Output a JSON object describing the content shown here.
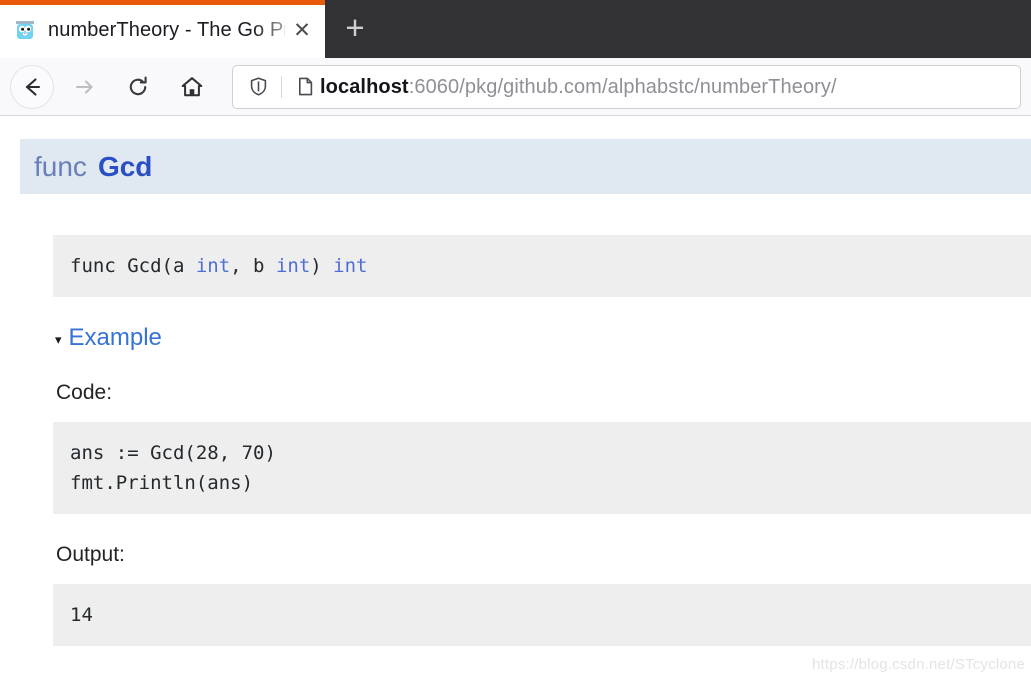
{
  "browser": {
    "tab": {
      "favicon": "go-gopher-icon",
      "title": "numberTheory - The Go Programming Language",
      "close_label": "✕"
    },
    "newtab_label": "+",
    "nav": {
      "back_label": "←",
      "forward_label": "→",
      "reload_label": "⟳",
      "home_label": "⌂"
    },
    "urlbar": {
      "shield_icon": "shield-icon",
      "page_icon": "page-info-icon",
      "host": "localhost",
      "path": ":6060/pkg/github.com/alphabstc/numberTheory/"
    }
  },
  "page": {
    "func_header": {
      "keyword": "func",
      "name": "Gcd"
    },
    "signature": "func Gcd(a int, b int) int",
    "signature_parts": {
      "pre": "func Gcd(a ",
      "type1": "int",
      "mid": ", b ",
      "type2": "int",
      "close": ") ",
      "type3": "int"
    },
    "example": {
      "caret": "▾",
      "label": "Example",
      "code_label": "Code:",
      "code": "ans := Gcd(28, 70)\nfmt.Println(ans)",
      "output_label": "Output:",
      "output": "14"
    },
    "watermark": "https://blog.csdn.net/STcyclone"
  },
  "colors": {
    "tabstrip_bg": "#323234",
    "tab_accent": "#e8590c",
    "header_band": "#e0e8f2",
    "func_name": "#2a4fc4",
    "code_bg": "#eeeeee",
    "link": "#3573d6"
  }
}
